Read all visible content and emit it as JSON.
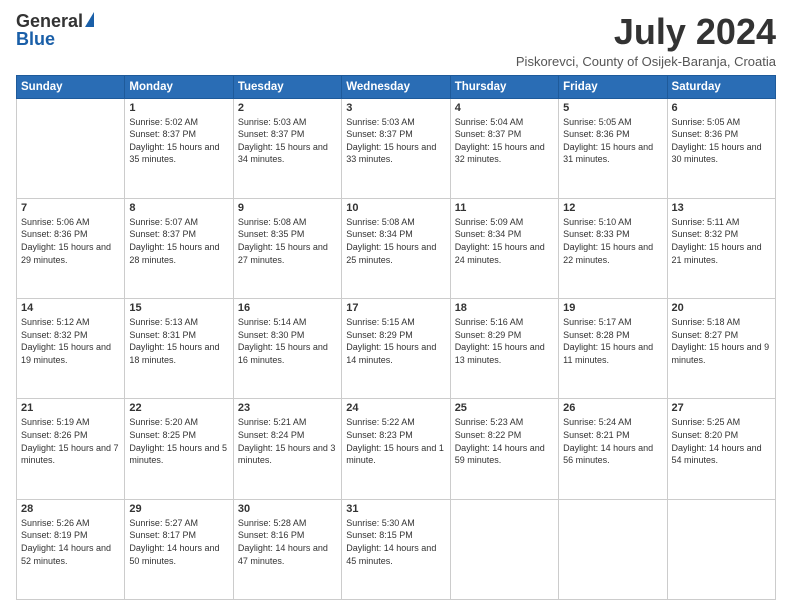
{
  "logo": {
    "general": "General",
    "blue": "Blue"
  },
  "title": "July 2024",
  "location": "Piskorevci, County of Osijek-Baranja, Croatia",
  "days": [
    "Sunday",
    "Monday",
    "Tuesday",
    "Wednesday",
    "Thursday",
    "Friday",
    "Saturday"
  ],
  "weeks": [
    [
      {
        "day": "",
        "sunrise": "",
        "sunset": "",
        "daylight": ""
      },
      {
        "day": "1",
        "sunrise": "Sunrise: 5:02 AM",
        "sunset": "Sunset: 8:37 PM",
        "daylight": "Daylight: 15 hours and 35 minutes."
      },
      {
        "day": "2",
        "sunrise": "Sunrise: 5:03 AM",
        "sunset": "Sunset: 8:37 PM",
        "daylight": "Daylight: 15 hours and 34 minutes."
      },
      {
        "day": "3",
        "sunrise": "Sunrise: 5:03 AM",
        "sunset": "Sunset: 8:37 PM",
        "daylight": "Daylight: 15 hours and 33 minutes."
      },
      {
        "day": "4",
        "sunrise": "Sunrise: 5:04 AM",
        "sunset": "Sunset: 8:37 PM",
        "daylight": "Daylight: 15 hours and 32 minutes."
      },
      {
        "day": "5",
        "sunrise": "Sunrise: 5:05 AM",
        "sunset": "Sunset: 8:36 PM",
        "daylight": "Daylight: 15 hours and 31 minutes."
      },
      {
        "day": "6",
        "sunrise": "Sunrise: 5:05 AM",
        "sunset": "Sunset: 8:36 PM",
        "daylight": "Daylight: 15 hours and 30 minutes."
      }
    ],
    [
      {
        "day": "7",
        "sunrise": "Sunrise: 5:06 AM",
        "sunset": "Sunset: 8:36 PM",
        "daylight": "Daylight: 15 hours and 29 minutes."
      },
      {
        "day": "8",
        "sunrise": "Sunrise: 5:07 AM",
        "sunset": "Sunset: 8:37 PM",
        "daylight": "Daylight: 15 hours and 28 minutes."
      },
      {
        "day": "9",
        "sunrise": "Sunrise: 5:08 AM",
        "sunset": "Sunset: 8:35 PM",
        "daylight": "Daylight: 15 hours and 27 minutes."
      },
      {
        "day": "10",
        "sunrise": "Sunrise: 5:08 AM",
        "sunset": "Sunset: 8:34 PM",
        "daylight": "Daylight: 15 hours and 25 minutes."
      },
      {
        "day": "11",
        "sunrise": "Sunrise: 5:09 AM",
        "sunset": "Sunset: 8:34 PM",
        "daylight": "Daylight: 15 hours and 24 minutes."
      },
      {
        "day": "12",
        "sunrise": "Sunrise: 5:10 AM",
        "sunset": "Sunset: 8:33 PM",
        "daylight": "Daylight: 15 hours and 22 minutes."
      },
      {
        "day": "13",
        "sunrise": "Sunrise: 5:11 AM",
        "sunset": "Sunset: 8:32 PM",
        "daylight": "Daylight: 15 hours and 21 minutes."
      }
    ],
    [
      {
        "day": "14",
        "sunrise": "Sunrise: 5:12 AM",
        "sunset": "Sunset: 8:32 PM",
        "daylight": "Daylight: 15 hours and 19 minutes."
      },
      {
        "day": "15",
        "sunrise": "Sunrise: 5:13 AM",
        "sunset": "Sunset: 8:31 PM",
        "daylight": "Daylight: 15 hours and 18 minutes."
      },
      {
        "day": "16",
        "sunrise": "Sunrise: 5:14 AM",
        "sunset": "Sunset: 8:30 PM",
        "daylight": "Daylight: 15 hours and 16 minutes."
      },
      {
        "day": "17",
        "sunrise": "Sunrise: 5:15 AM",
        "sunset": "Sunset: 8:29 PM",
        "daylight": "Daylight: 15 hours and 14 minutes."
      },
      {
        "day": "18",
        "sunrise": "Sunrise: 5:16 AM",
        "sunset": "Sunset: 8:29 PM",
        "daylight": "Daylight: 15 hours and 13 minutes."
      },
      {
        "day": "19",
        "sunrise": "Sunrise: 5:17 AM",
        "sunset": "Sunset: 8:28 PM",
        "daylight": "Daylight: 15 hours and 11 minutes."
      },
      {
        "day": "20",
        "sunrise": "Sunrise: 5:18 AM",
        "sunset": "Sunset: 8:27 PM",
        "daylight": "Daylight: 15 hours and 9 minutes."
      }
    ],
    [
      {
        "day": "21",
        "sunrise": "Sunrise: 5:19 AM",
        "sunset": "Sunset: 8:26 PM",
        "daylight": "Daylight: 15 hours and 7 minutes."
      },
      {
        "day": "22",
        "sunrise": "Sunrise: 5:20 AM",
        "sunset": "Sunset: 8:25 PM",
        "daylight": "Daylight: 15 hours and 5 minutes."
      },
      {
        "day": "23",
        "sunrise": "Sunrise: 5:21 AM",
        "sunset": "Sunset: 8:24 PM",
        "daylight": "Daylight: 15 hours and 3 minutes."
      },
      {
        "day": "24",
        "sunrise": "Sunrise: 5:22 AM",
        "sunset": "Sunset: 8:23 PM",
        "daylight": "Daylight: 15 hours and 1 minute."
      },
      {
        "day": "25",
        "sunrise": "Sunrise: 5:23 AM",
        "sunset": "Sunset: 8:22 PM",
        "daylight": "Daylight: 14 hours and 59 minutes."
      },
      {
        "day": "26",
        "sunrise": "Sunrise: 5:24 AM",
        "sunset": "Sunset: 8:21 PM",
        "daylight": "Daylight: 14 hours and 56 minutes."
      },
      {
        "day": "27",
        "sunrise": "Sunrise: 5:25 AM",
        "sunset": "Sunset: 8:20 PM",
        "daylight": "Daylight: 14 hours and 54 minutes."
      }
    ],
    [
      {
        "day": "28",
        "sunrise": "Sunrise: 5:26 AM",
        "sunset": "Sunset: 8:19 PM",
        "daylight": "Daylight: 14 hours and 52 minutes."
      },
      {
        "day": "29",
        "sunrise": "Sunrise: 5:27 AM",
        "sunset": "Sunset: 8:17 PM",
        "daylight": "Daylight: 14 hours and 50 minutes."
      },
      {
        "day": "30",
        "sunrise": "Sunrise: 5:28 AM",
        "sunset": "Sunset: 8:16 PM",
        "daylight": "Daylight: 14 hours and 47 minutes."
      },
      {
        "day": "31",
        "sunrise": "Sunrise: 5:30 AM",
        "sunset": "Sunset: 8:15 PM",
        "daylight": "Daylight: 14 hours and 45 minutes."
      },
      {
        "day": "",
        "sunrise": "",
        "sunset": "",
        "daylight": ""
      },
      {
        "day": "",
        "sunrise": "",
        "sunset": "",
        "daylight": ""
      },
      {
        "day": "",
        "sunrise": "",
        "sunset": "",
        "daylight": ""
      }
    ]
  ]
}
